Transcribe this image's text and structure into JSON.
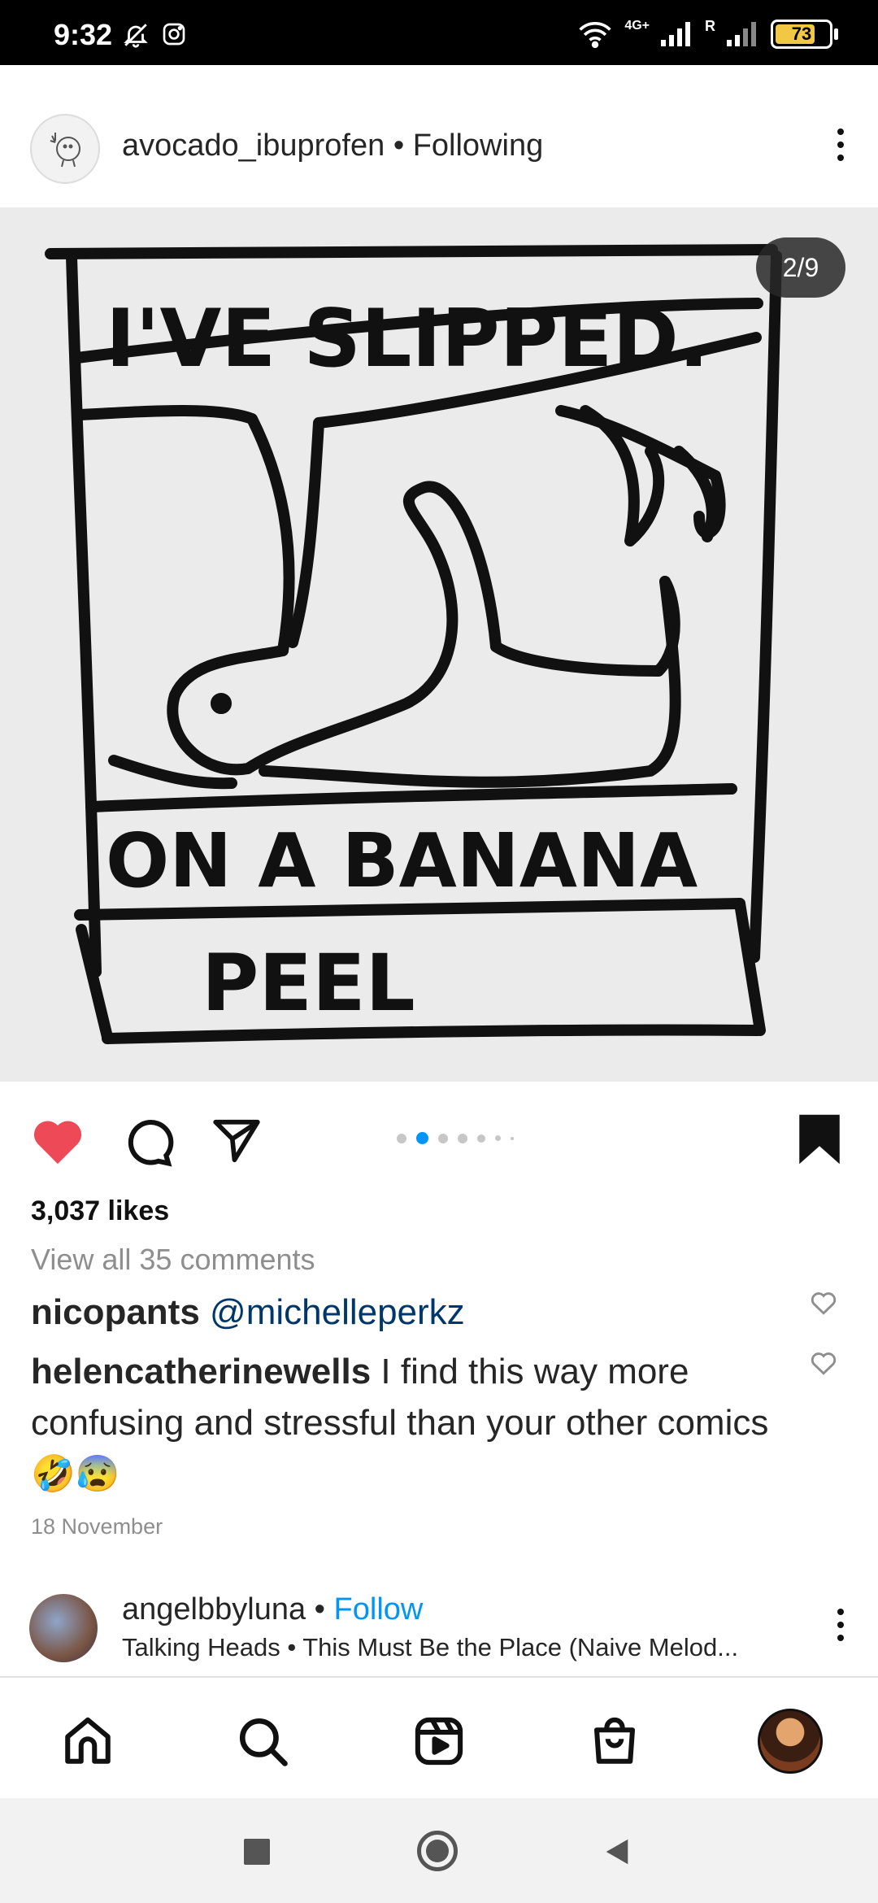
{
  "status_bar": {
    "time": "9:32",
    "battery": "73",
    "network": "4G+",
    "roaming": "R"
  },
  "post": {
    "username": "avocado_ibuprofen",
    "relation": "• Following",
    "page_indicator": "2/9",
    "image_text": {
      "top": "I'VE SLIPPED.",
      "middle": "ON A BANANA",
      "bottom": "PEEL"
    },
    "likes": "3,037 likes",
    "view_comments": "View all 35 comments",
    "comments": [
      {
        "user": "nicopants",
        "text": "@michelleperkz"
      },
      {
        "user": "helencatherinewells",
        "text": "I find this way more confusing and stressful than your other comics 🤣😰"
      }
    ],
    "date": "18 November"
  },
  "next_post": {
    "username": "angelbbyluna",
    "separator": "•",
    "follow": "Follow",
    "music": "Talking Heads • This Must Be the Place (Naive Melod..."
  },
  "colors": {
    "like_red": "#ed4956",
    "follow_blue": "#0095f6",
    "mention_blue": "#00376b",
    "active_dot": "#0095f6"
  }
}
